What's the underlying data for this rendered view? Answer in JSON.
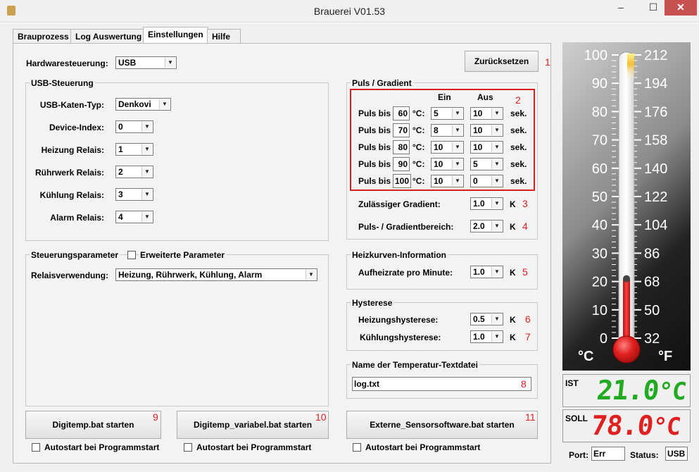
{
  "window": {
    "title": "Brauerei V01.53"
  },
  "tabs": [
    "Brauprozess",
    "Log Auswertung",
    "Einstellungen",
    "Hilfe"
  ],
  "hardware": {
    "label": "Hardwaresteuerung:",
    "value": "USB",
    "reset_button": "Zurücksetzen",
    "marker": "1"
  },
  "usb": {
    "title": "USB-Steuerung",
    "rows": [
      {
        "label": "USB-Katen-Typ:",
        "value": "Denkovi"
      },
      {
        "label": "Device-Index:",
        "value": "0"
      },
      {
        "label": "Heizung Relais:",
        "value": "1"
      },
      {
        "label": "Rührwerk Relais:",
        "value": "2"
      },
      {
        "label": "Kühlung Relais:",
        "value": "3"
      },
      {
        "label": "Alarm Relais:",
        "value": "4"
      }
    ]
  },
  "params": {
    "title": "Steuerungsparameter",
    "extended_label": "Erweiterte Parameter",
    "relay_label": "Relaisverwendung:",
    "relay_value": "Heizung, Rührwerk, Kühlung, Alarm"
  },
  "puls": {
    "title": "Puls / Gradient",
    "col_ein": "Ein",
    "col_aus": "Aus",
    "marker": "2",
    "row_label": "Puls bis",
    "unit": "°C:",
    "sek": "sek.",
    "rows": [
      {
        "temp": "60",
        "ein": "5",
        "aus": "10"
      },
      {
        "temp": "70",
        "ein": "8",
        "aus": "10"
      },
      {
        "temp": "80",
        "ein": "10",
        "aus": "10"
      },
      {
        "temp": "90",
        "ein": "10",
        "aus": "5"
      },
      {
        "temp": "100",
        "ein": "10",
        "aus": "0"
      }
    ],
    "gradient_label": "Zulässiger Gradient:",
    "gradient_value": "1.0",
    "gradient_marker": "3",
    "range_label": "Puls- / Gradientbereich:",
    "range_value": "2.0",
    "range_marker": "4",
    "unit_k": "K"
  },
  "heizkurve": {
    "title": "Heizkurven-Information",
    "label": "Aufheizrate pro Minute:",
    "value": "1.0",
    "marker": "5"
  },
  "hysterese": {
    "title": "Hysterese",
    "heiz_label": "Heizungshysterese:",
    "heiz_value": "0.5",
    "heiz_marker": "6",
    "kuehl_label": "Kühlungshysterese:",
    "kuehl_value": "1.0",
    "kuehl_marker": "7"
  },
  "textfile": {
    "title": "Name der Temperatur-Textdatei",
    "value": "log.txt",
    "marker": "8"
  },
  "buttons": [
    {
      "label": "Digitemp.bat starten",
      "marker": "9",
      "autostart": "Autostart bei Programmstart"
    },
    {
      "label": "Digitemp_variabel.bat starten",
      "marker": "10",
      "autostart": "Autostart bei Programmstart"
    },
    {
      "label": "Externe_Sensorsoftware.bat starten",
      "marker": "11",
      "autostart": "Autostart bei Programmstart"
    }
  ],
  "thermometer": {
    "celsius_ticks": [
      "100",
      "90",
      "80",
      "70",
      "60",
      "50",
      "40",
      "30",
      "20",
      "10",
      "0"
    ],
    "fahrenheit_ticks": [
      "212",
      "194",
      "176",
      "158",
      "140",
      "122",
      "104",
      "86",
      "68",
      "50",
      "32"
    ],
    "unit_c": "°C",
    "unit_f": "°F",
    "fill_celsius": 21.0
  },
  "ist": {
    "label": "IST",
    "value": "21.0",
    "unit": "°C",
    "color": "#22aa22"
  },
  "soll": {
    "label": "SOLL",
    "value": "78.0",
    "unit": "°C",
    "color": "#e02020"
  },
  "status": {
    "port_label": "Port:",
    "port_value": "Err",
    "status_label": "Status:",
    "status_value": "USB"
  }
}
